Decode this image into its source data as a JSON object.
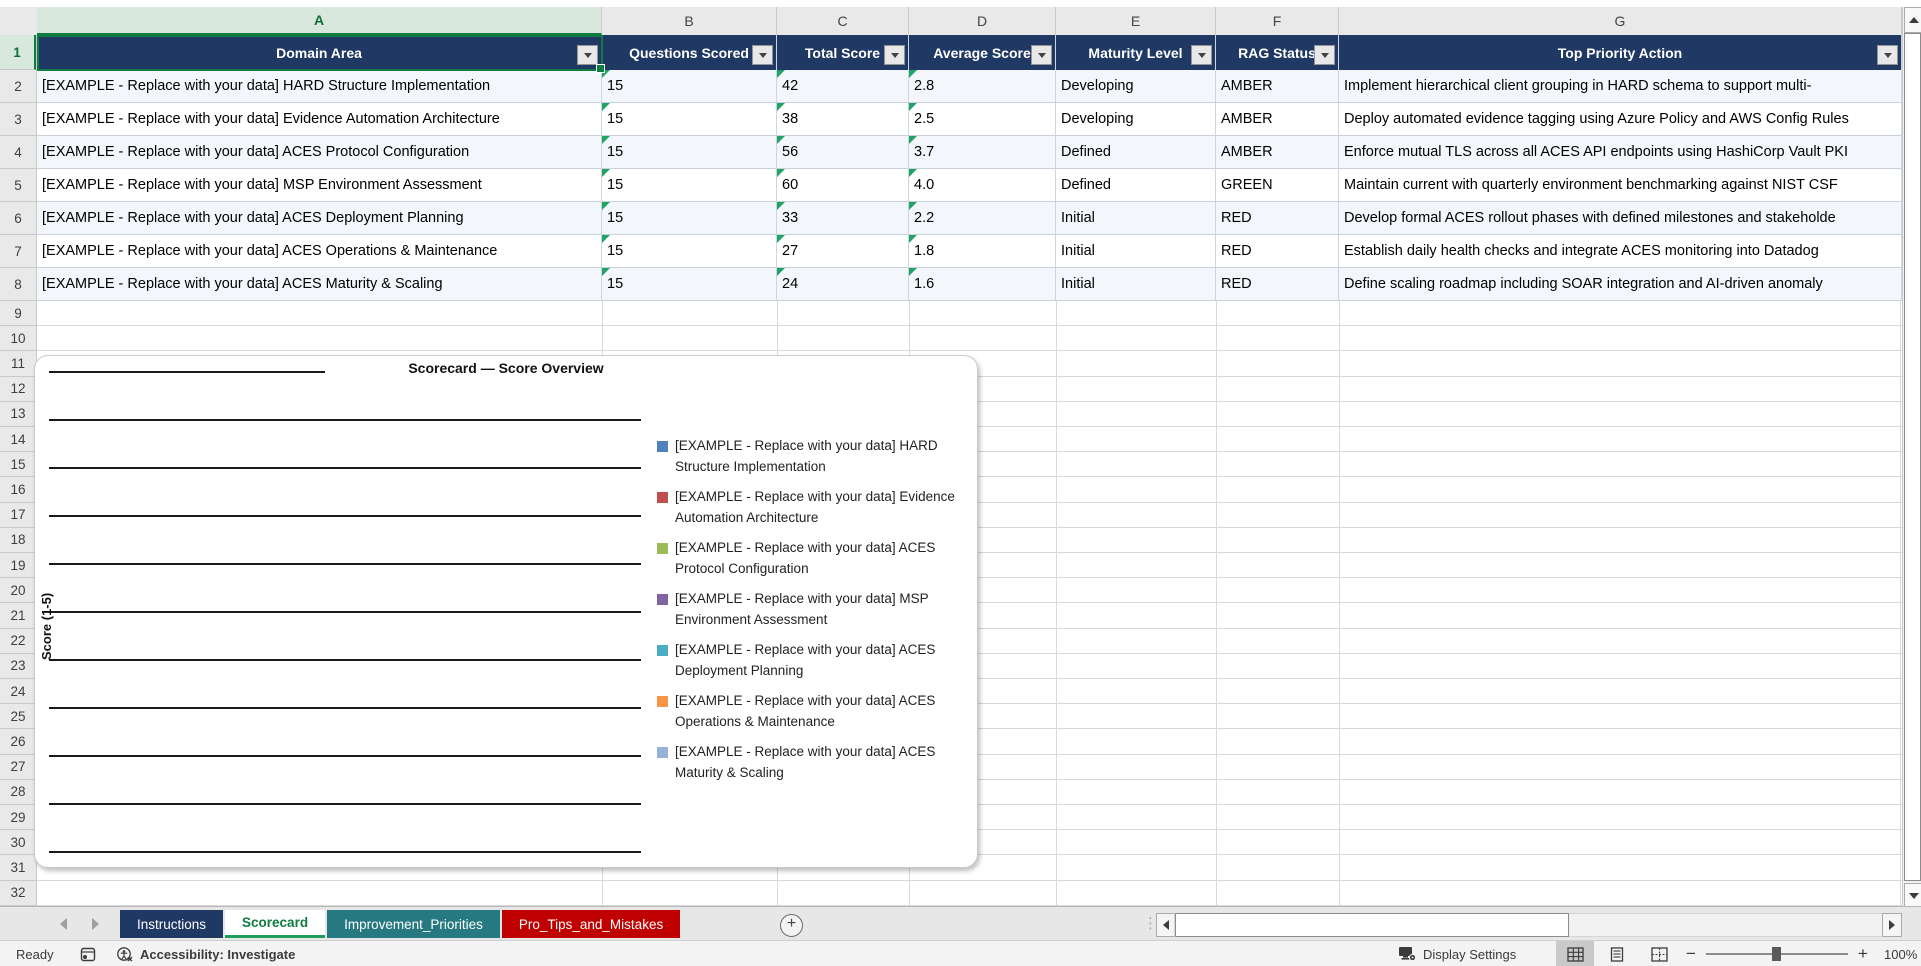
{
  "columns": [
    {
      "letter": "A"
    },
    {
      "letter": "B"
    },
    {
      "letter": "C"
    },
    {
      "letter": "D"
    },
    {
      "letter": "E"
    },
    {
      "letter": "F"
    },
    {
      "letter": "G"
    }
  ],
  "selection": {
    "cell": "A1",
    "border_color": "#107C41"
  },
  "rows_visible": {
    "first": 1,
    "last": 32
  },
  "table": {
    "header_fill": "#203864",
    "headers": [
      "Domain Area",
      "Questions Scored",
      "Total Score",
      "Average Score",
      "Maturity Level",
      "RAG Status",
      "Top Priority Action"
    ],
    "rows": [
      [
        "[EXAMPLE - Replace with your data] HARD Structure Implementation",
        "15",
        "42",
        "2.8",
        "Developing",
        "AMBER",
        "Implement hierarchical client grouping in HARD schema to support multi-"
      ],
      [
        "[EXAMPLE - Replace with your data] Evidence Automation Architecture",
        "15",
        "38",
        "2.5",
        "Developing",
        "AMBER",
        "Deploy automated evidence tagging using Azure Policy and AWS Config Rules"
      ],
      [
        "[EXAMPLE - Replace with your data] ACES Protocol Configuration",
        "15",
        "56",
        "3.7",
        "Defined",
        "AMBER",
        "Enforce mutual TLS across all ACES API endpoints using HashiCorp Vault PKI"
      ],
      [
        "[EXAMPLE - Replace with your data] MSP Environment Assessment",
        "15",
        "60",
        "4.0",
        "Defined",
        "GREEN",
        "Maintain current with quarterly environment benchmarking against NIST CSF"
      ],
      [
        "[EXAMPLE - Replace with your data] ACES Deployment Planning",
        "15",
        "33",
        "2.2",
        "Initial",
        "RED",
        "Develop formal ACES rollout phases with defined milestones and stakeholde"
      ],
      [
        "[EXAMPLE - Replace with your data] ACES Operations & Maintenance",
        "15",
        "27",
        "1.8",
        "Initial",
        "RED",
        "Establish daily health checks and integrate ACES monitoring into Datadog"
      ],
      [
        "[EXAMPLE - Replace with your data] ACES Maturity & Scaling",
        "15",
        "24",
        "1.6",
        "Initial",
        "RED",
        "Define scaling roadmap including SOAR integration and AI-driven anomaly"
      ]
    ]
  },
  "chart_data": {
    "type": "bar",
    "title": "Scorecard — Score Overview",
    "ylabel": "Score (1-5)",
    "bars_visible": false,
    "gridline_count": 11,
    "legend_position": "right",
    "series": [
      {
        "name": "[EXAMPLE - Replace with your data] HARD Structure Implementation",
        "color": "#4F81BD"
      },
      {
        "name": "[EXAMPLE - Replace with your data] Evidence Automation Architecture",
        "color": "#C0504D"
      },
      {
        "name": "[EXAMPLE - Replace with your data] ACES Protocol Configuration",
        "color": "#9BBB59"
      },
      {
        "name": "[EXAMPLE - Replace with your data] MSP Environment Assessment",
        "color": "#8064A2"
      },
      {
        "name": "[EXAMPLE - Replace with your data] ACES Deployment Planning",
        "color": "#4BACC6"
      },
      {
        "name": "[EXAMPLE - Replace with your data] ACES Operations & Maintenance",
        "color": "#F79646"
      },
      {
        "name": "[EXAMPLE - Replace with your data] ACES Maturity & Scaling",
        "color": "#95B3D7"
      }
    ]
  },
  "sheet_tabs": {
    "items": [
      {
        "label": "Instructions",
        "bg": "#203864",
        "fg": "#FFFFFF",
        "active": false
      },
      {
        "label": "Scorecard",
        "bg": "#FFFFFF",
        "fg": "#107C41",
        "active": true
      },
      {
        "label": "Improvement_Priorities",
        "bg": "#267980",
        "fg": "#FFFFFF",
        "active": false
      },
      {
        "label": "Pro_Tips_and_Mistakes",
        "bg": "#C00000",
        "fg": "#FFFFFF",
        "active": false
      }
    ]
  },
  "status_bar": {
    "ready": "Ready",
    "accessibility": "Accessibility: Investigate",
    "display_settings": "Display Settings",
    "zoom": "100%"
  }
}
